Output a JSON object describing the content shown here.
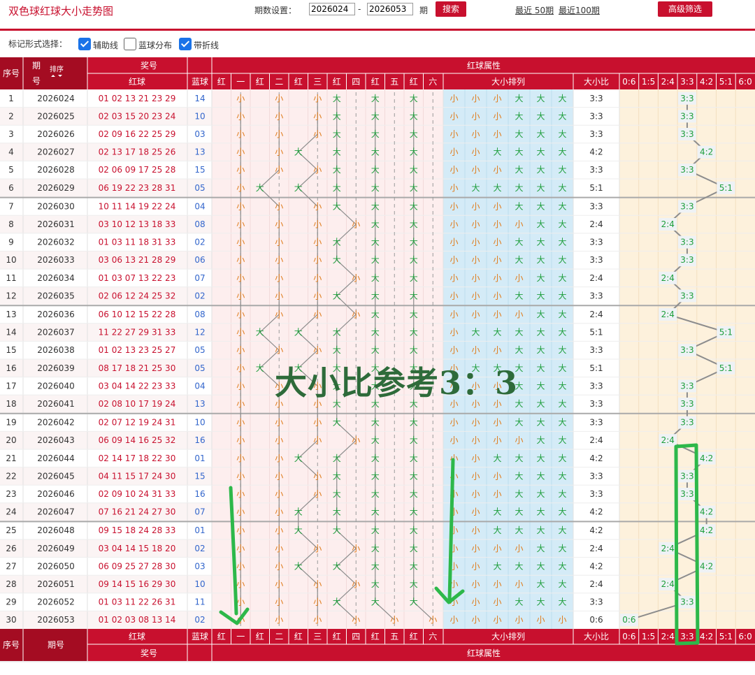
{
  "header": {
    "title": "双色球红球大小走势图",
    "period_label": "期数设置：",
    "start": "2026024",
    "dash": "-",
    "end": "2026053",
    "period_suffix": "期",
    "search_label": "搜索",
    "recent50": "最近 50期",
    "recent100": "最近100期",
    "advanced_label": "高级筛选"
  },
  "options": {
    "label": "标记形式选择：",
    "items": [
      {
        "label": "辅助线",
        "checked": true
      },
      {
        "label": "蓝球分布",
        "checked": false
      },
      {
        "label": "带折线",
        "checked": true
      }
    ]
  },
  "overlay": {
    "text": "大小比参考3：3"
  },
  "colors": {
    "brand": "#c8102e",
    "big": "#1e9e3c",
    "small": "#e07b1a",
    "blue_ball": "#3366cc",
    "annotation": "#2db84a"
  },
  "table": {
    "h_seq": "序号",
    "h_issue": "期号",
    "h_sort": "排序",
    "h_prize": "奖号",
    "h_red": "红球",
    "h_blue": "蓝球",
    "h_attr": "红球属性",
    "h_arrange": "大小排列",
    "h_ratio": "大小比",
    "pos_headers": [
      "红",
      "一",
      "红",
      "二",
      "红",
      "三",
      "红",
      "四",
      "红",
      "五",
      "红",
      "六"
    ],
    "ratio_cols": [
      "0:6",
      "1:5",
      "2:4",
      "3:3",
      "4:2",
      "5:1",
      "6:0"
    ],
    "rows": [
      {
        "seq": "1",
        "issue": "2026024",
        "red": "01 02 13 21 23 29",
        "blue": "14",
        "sizes": [
          "小",
          "小",
          "小",
          "大",
          "大",
          "大"
        ],
        "ratio": "3:3"
      },
      {
        "seq": "2",
        "issue": "2026025",
        "red": "02 03 15 20 23 24",
        "blue": "10",
        "sizes": [
          "小",
          "小",
          "小",
          "大",
          "大",
          "大"
        ],
        "ratio": "3:3"
      },
      {
        "seq": "3",
        "issue": "2026026",
        "red": "02 09 16 22 25 29",
        "blue": "03",
        "sizes": [
          "小",
          "小",
          "小",
          "大",
          "大",
          "大"
        ],
        "ratio": "3:3"
      },
      {
        "seq": "4",
        "issue": "2026027",
        "red": "02 13 17 18 25 26",
        "blue": "13",
        "sizes": [
          "小",
          "小",
          "大",
          "大",
          "大",
          "大"
        ],
        "ratio": "4:2"
      },
      {
        "seq": "5",
        "issue": "2026028",
        "red": "02 06 09 17 25 28",
        "blue": "15",
        "sizes": [
          "小",
          "小",
          "小",
          "大",
          "大",
          "大"
        ],
        "ratio": "3:3"
      },
      {
        "seq": "6",
        "issue": "2026029",
        "red": "06 19 22 23 28 31",
        "blue": "05",
        "sizes": [
          "小",
          "大",
          "大",
          "大",
          "大",
          "大"
        ],
        "ratio": "5:1"
      },
      {
        "seq": "7",
        "issue": "2026030",
        "red": "10 11 14 19 22 24",
        "blue": "04",
        "sizes": [
          "小",
          "小",
          "小",
          "大",
          "大",
          "大"
        ],
        "ratio": "3:3"
      },
      {
        "seq": "8",
        "issue": "2026031",
        "red": "03 10 12 13 18 33",
        "blue": "08",
        "sizes": [
          "小",
          "小",
          "小",
          "小",
          "大",
          "大"
        ],
        "ratio": "2:4"
      },
      {
        "seq": "9",
        "issue": "2026032",
        "red": "01 03 11 18 31 33",
        "blue": "02",
        "sizes": [
          "小",
          "小",
          "小",
          "大",
          "大",
          "大"
        ],
        "ratio": "3:3"
      },
      {
        "seq": "10",
        "issue": "2026033",
        "red": "03 06 13 21 28 29",
        "blue": "06",
        "sizes": [
          "小",
          "小",
          "小",
          "大",
          "大",
          "大"
        ],
        "ratio": "3:3"
      },
      {
        "seq": "11",
        "issue": "2026034",
        "red": "01 03 07 13 22 23",
        "blue": "07",
        "sizes": [
          "小",
          "小",
          "小",
          "小",
          "大",
          "大"
        ],
        "ratio": "2:4"
      },
      {
        "seq": "12",
        "issue": "2026035",
        "red": "02 06 12 24 25 32",
        "blue": "02",
        "sizes": [
          "小",
          "小",
          "小",
          "大",
          "大",
          "大"
        ],
        "ratio": "3:3"
      },
      {
        "seq": "13",
        "issue": "2026036",
        "red": "06 10 12 15 22 28",
        "blue": "08",
        "sizes": [
          "小",
          "小",
          "小",
          "小",
          "大",
          "大"
        ],
        "ratio": "2:4"
      },
      {
        "seq": "14",
        "issue": "2026037",
        "red": "11 22 27 29 31 33",
        "blue": "12",
        "sizes": [
          "小",
          "大",
          "大",
          "大",
          "大",
          "大"
        ],
        "ratio": "5:1"
      },
      {
        "seq": "15",
        "issue": "2026038",
        "red": "01 02 13 23 25 27",
        "blue": "05",
        "sizes": [
          "小",
          "小",
          "小",
          "大",
          "大",
          "大"
        ],
        "ratio": "3:3"
      },
      {
        "seq": "16",
        "issue": "2026039",
        "red": "08 17 18 21 25 30",
        "blue": "05",
        "sizes": [
          "小",
          "大",
          "大",
          "大",
          "大",
          "大"
        ],
        "ratio": "5:1"
      },
      {
        "seq": "17",
        "issue": "2026040",
        "red": "03 04 14 22 23 33",
        "blue": "04",
        "sizes": [
          "小",
          "小",
          "小",
          "大",
          "大",
          "大"
        ],
        "ratio": "3:3"
      },
      {
        "seq": "18",
        "issue": "2026041",
        "red": "02 08 10 17 19 24",
        "blue": "13",
        "sizes": [
          "小",
          "小",
          "小",
          "大",
          "大",
          "大"
        ],
        "ratio": "3:3"
      },
      {
        "seq": "19",
        "issue": "2026042",
        "red": "02 07 12 19 24 31",
        "blue": "10",
        "sizes": [
          "小",
          "小",
          "小",
          "大",
          "大",
          "大"
        ],
        "ratio": "3:3"
      },
      {
        "seq": "20",
        "issue": "2026043",
        "red": "06 09 14 16 25 32",
        "blue": "16",
        "sizes": [
          "小",
          "小",
          "小",
          "小",
          "大",
          "大"
        ],
        "ratio": "2:4"
      },
      {
        "seq": "21",
        "issue": "2026044",
        "red": "02 14 17 18 22 30",
        "blue": "01",
        "sizes": [
          "小",
          "小",
          "大",
          "大",
          "大",
          "大"
        ],
        "ratio": "4:2"
      },
      {
        "seq": "22",
        "issue": "2026045",
        "red": "04 11 15 17 24 30",
        "blue": "15",
        "sizes": [
          "小",
          "小",
          "小",
          "大",
          "大",
          "大"
        ],
        "ratio": "3:3"
      },
      {
        "seq": "23",
        "issue": "2026046",
        "red": "02 09 10 24 31 33",
        "blue": "16",
        "sizes": [
          "小",
          "小",
          "小",
          "大",
          "大",
          "大"
        ],
        "ratio": "3:3"
      },
      {
        "seq": "24",
        "issue": "2026047",
        "red": "07 16 21 24 27 30",
        "blue": "07",
        "sizes": [
          "小",
          "小",
          "大",
          "大",
          "大",
          "大"
        ],
        "ratio": "4:2"
      },
      {
        "seq": "25",
        "issue": "2026048",
        "red": "09 15 18 24 28 33",
        "blue": "01",
        "sizes": [
          "小",
          "小",
          "大",
          "大",
          "大",
          "大"
        ],
        "ratio": "4:2"
      },
      {
        "seq": "26",
        "issue": "2026049",
        "red": "03 04 14 15 18 20",
        "blue": "02",
        "sizes": [
          "小",
          "小",
          "小",
          "小",
          "大",
          "大"
        ],
        "ratio": "2:4"
      },
      {
        "seq": "27",
        "issue": "2026050",
        "red": "06 09 25 27 28 30",
        "blue": "03",
        "sizes": [
          "小",
          "小",
          "大",
          "大",
          "大",
          "大"
        ],
        "ratio": "4:2"
      },
      {
        "seq": "28",
        "issue": "2026051",
        "red": "09 14 15 16 29 30",
        "blue": "10",
        "sizes": [
          "小",
          "小",
          "小",
          "小",
          "大",
          "大"
        ],
        "ratio": "2:4"
      },
      {
        "seq": "29",
        "issue": "2026052",
        "red": "01 03 11 22 26 31",
        "blue": "11",
        "sizes": [
          "小",
          "小",
          "小",
          "大",
          "大",
          "大"
        ],
        "ratio": "3:3"
      },
      {
        "seq": "30",
        "issue": "2026053",
        "red": "01 02 03 08 13 14",
        "blue": "02",
        "sizes": [
          "小",
          "小",
          "小",
          "小",
          "小",
          "小"
        ],
        "ratio": "0:6"
      }
    ]
  }
}
